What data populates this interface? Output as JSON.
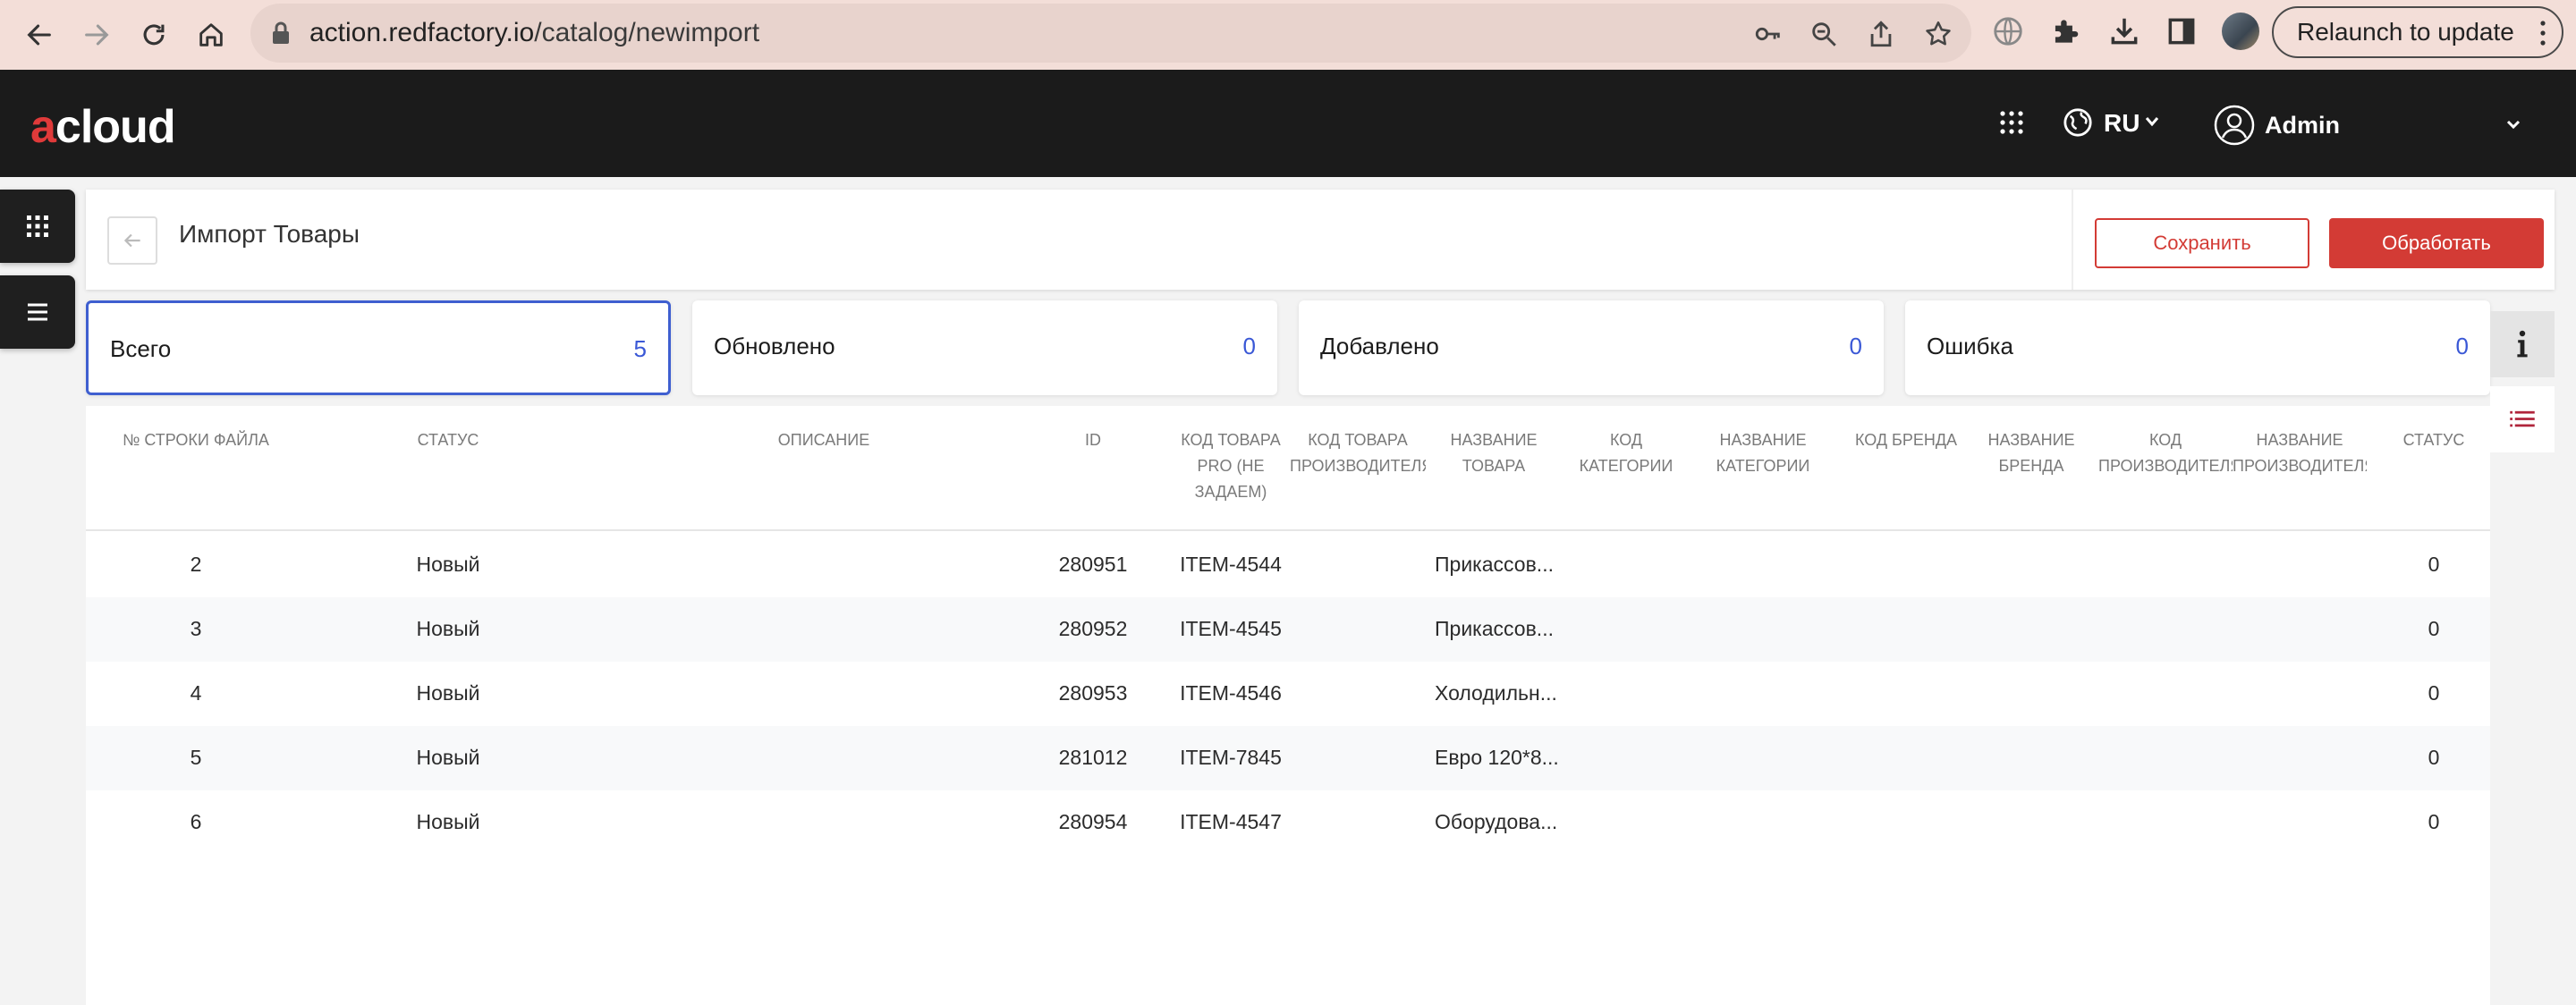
{
  "browser": {
    "url_host": "action.redfactory.io",
    "url_path": "/catalog/newimport",
    "relaunch_label": "Relaunch to update"
  },
  "header": {
    "logo_a": "a",
    "logo_rest": "cloud",
    "language": "RU",
    "user_name": "Admin"
  },
  "toolbar": {
    "title": "Импорт Товары",
    "save_label": "Сохранить",
    "process_label": "Обработать"
  },
  "stats": [
    {
      "label": "Всего",
      "value": "5"
    },
    {
      "label": "Обновлено",
      "value": "0"
    },
    {
      "label": "Добавлено",
      "value": "0"
    },
    {
      "label": "Ошибка",
      "value": "0"
    }
  ],
  "table": {
    "columns": [
      "№ строки файла",
      "Статус",
      "Описание",
      "ID",
      "Код товара PRO (не задаем)",
      "Код товара производителя",
      "Название товара",
      "Код категории",
      "Название категории",
      "Код бренда",
      "Название бренда",
      "Код производителя",
      "Название производителя",
      "Статус"
    ],
    "rows": [
      {
        "line": "2",
        "status": "Новый",
        "id": "280951",
        "code": "ITEM-4544",
        "name": "Прикассов...",
        "status2": "0"
      },
      {
        "line": "3",
        "status": "Новый",
        "id": "280952",
        "code": "ITEM-4545",
        "name": "Прикассов...",
        "status2": "0"
      },
      {
        "line": "4",
        "status": "Новый",
        "id": "280953",
        "code": "ITEM-4546",
        "name": "Холодильн...",
        "status2": "0"
      },
      {
        "line": "5",
        "status": "Новый",
        "id": "281012",
        "code": "ITEM-7845",
        "name": "Евро 120*8...",
        "status2": "0"
      },
      {
        "line": "6",
        "status": "Новый",
        "id": "280954",
        "code": "ITEM-4547",
        "name": "Оборудова...",
        "status2": "0"
      }
    ]
  },
  "colors": {
    "accent_red": "#d33b35",
    "accent_blue": "#3a58d6",
    "header_bg": "#1b1b1b"
  }
}
